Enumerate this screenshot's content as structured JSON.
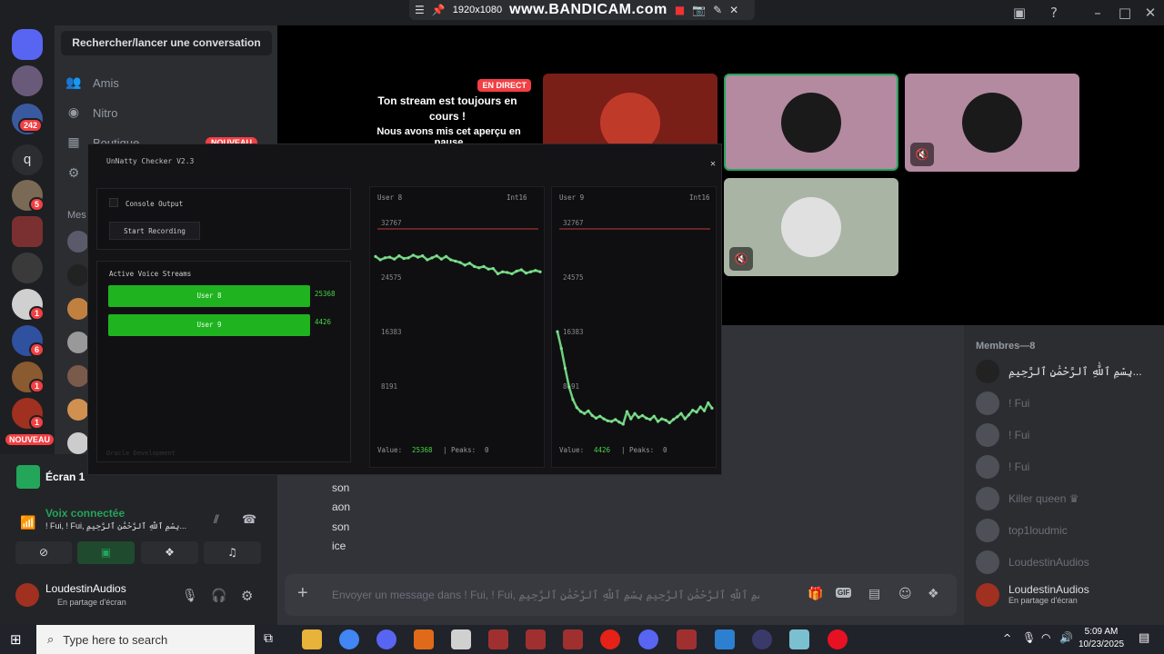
{
  "bandicam": {
    "resolution": "1920x1080",
    "watermark": "www.BANDICAM.com"
  },
  "sidebar": {
    "search_label": "Rechercher/lancer une conversation",
    "nav": [
      {
        "label": "Amis",
        "icon": "people-icon"
      },
      {
        "label": "Nitro",
        "icon": "nitro-icon"
      },
      {
        "label": "Boutique",
        "icon": "shop-icon",
        "tag": "NOUVEAU"
      }
    ],
    "dm_header": "Mes",
    "servers": {
      "badge_242": "242",
      "letter": "q",
      "badge_5": "5",
      "badge_1": "1",
      "badge_6": "6",
      "nouveau": "NOUVEAU"
    }
  },
  "voice": {
    "screen_label": "Écran 1",
    "status": "Voix connectée",
    "channel": "! Fui, ! Fui, بِسْمِ ٱللَّٰهِ ٱلرَّحْمَٰنِ ٱلرَّحِيمِ...",
    "user_name": "LoudestinAudios",
    "user_status": "En partage d'écran"
  },
  "stream": {
    "live_badge": "EN DIRECT",
    "msg_title": "Ton stream est toujours en cours !",
    "msg_body": "Nous avons mis cet aperçu en pause"
  },
  "chat": {
    "lines": [
      "son",
      "aon",
      "son",
      "ice"
    ],
    "composer_placeholder": "Envoyer un message dans ! Fui, ! Fui, بِسْمِ ٱللَّٰهِ ٱلرَّحْمَٰنِ ٱلرَّحِيمِ بِسْمِ ٱللَّٰهِ ٱلرَّحْمَٰنِ ٱلرَّحِيمِ"
  },
  "members": {
    "header": "Membres—8",
    "list": [
      "بِسْمِ ٱللَّٰهِ ٱلرَّحْمَٰنِ ٱلرَّحِيمِ...",
      "! Fui",
      "! Fui",
      "! Fui",
      "Killer queen ♛",
      "top1loudmic",
      "LoudestinAudios",
      "LoudestinAudios"
    ],
    "last_status": "En partage d'écran"
  },
  "checker": {
    "title": "UnNatty Checker V2.3",
    "console_output": "Console Output",
    "start_recording": "Start Recording",
    "active_streams": "Active Voice Streams",
    "streams": [
      {
        "name": "User 8",
        "value": "25368"
      },
      {
        "name": "User 9",
        "value": "4426"
      }
    ],
    "footer": "Oracle Development",
    "graphs": [
      {
        "user": "User 8",
        "type": "Int16",
        "value": "25368",
        "peaks": "0"
      },
      {
        "user": "User 9",
        "type": "Int16",
        "value": "4426",
        "peaks": "0"
      }
    ],
    "value_label": "Value:",
    "peaks_label": "| Peaks:"
  },
  "chart_data": [
    {
      "type": "line",
      "title": "User 8",
      "ylim": [
        0,
        32767
      ],
      "yticks": [
        "32767",
        "24575",
        "16383",
        "8191"
      ],
      "x": [
        0,
        1,
        2,
        3,
        4,
        5,
        6,
        7,
        8,
        9,
        10,
        11,
        12,
        13,
        14,
        15,
        16,
        17,
        18,
        19,
        20,
        21,
        22,
        23,
        24,
        25,
        26,
        27,
        28,
        29,
        30,
        31,
        32,
        33,
        34,
        35
      ],
      "values": [
        27800,
        27300,
        27600,
        27700,
        27400,
        27900,
        27500,
        27600,
        28000,
        27700,
        27900,
        27300,
        27600,
        27900,
        27400,
        27800,
        27300,
        27100,
        26900,
        26500,
        26800,
        26300,
        26100,
        26300,
        25900,
        26000,
        25200,
        25500,
        25400,
        25200,
        25600,
        25800,
        25300,
        25500,
        25700,
        25500
      ]
    },
    {
      "type": "line",
      "title": "User 9",
      "ylim": [
        0,
        32767
      ],
      "yticks": [
        "32767",
        "24575",
        "16383",
        "8191"
      ],
      "x": [
        0,
        1,
        2,
        3,
        4,
        5,
        6,
        7,
        8,
        9,
        10,
        11,
        12,
        13,
        14,
        15,
        16,
        17,
        18,
        19,
        20,
        21,
        22,
        23,
        24,
        25,
        26,
        27,
        28,
        29,
        30,
        31,
        32,
        33,
        34,
        35,
        36,
        37,
        38,
        39,
        40
      ],
      "values": [
        16500,
        14000,
        11000,
        8200,
        6300,
        5100,
        4500,
        4200,
        4600,
        3900,
        3500,
        3800,
        3400,
        3100,
        3000,
        3300,
        2900,
        2600,
        4500,
        3400,
        4200,
        3600,
        3900,
        3500,
        3300,
        3800,
        3000,
        3400,
        3200,
        2800,
        3300,
        3700,
        4200,
        3400,
        4000,
        4700,
        4400,
        5200,
        4600,
        5800,
        5000
      ]
    }
  ]
}
